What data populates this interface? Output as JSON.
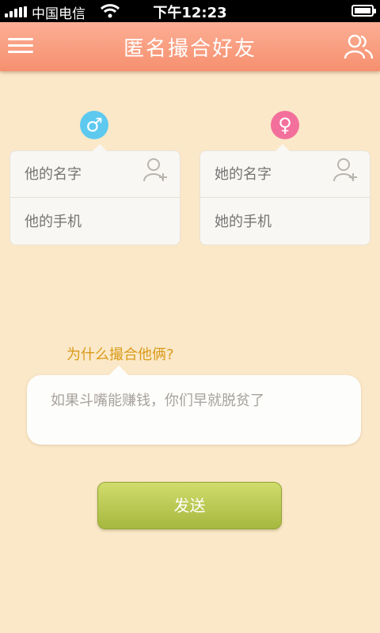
{
  "status": {
    "carrier": "中国电信",
    "time": "下午12:23"
  },
  "header": {
    "title": "匿名撮合好友",
    "menu_icon": "menu-icon",
    "friends_icon": "friends-icon"
  },
  "him": {
    "gender_symbol": "♂",
    "gender_color": "#5ec9ef",
    "name_placeholder": "他的名字",
    "phone_placeholder": "他的手机"
  },
  "her": {
    "gender_symbol": "♀",
    "gender_color": "#f3709c",
    "name_placeholder": "她的名字",
    "phone_placeholder": "她的手机"
  },
  "reason": {
    "label": "为什么撮合他俩?",
    "text": "如果斗嘴能赚钱，你们早就脱贫了"
  },
  "send_label": "发送",
  "colors": {
    "background": "#fbe8c8",
    "header": "#f6906f",
    "accent": "#d99b1a",
    "button": "#b2c24c"
  }
}
